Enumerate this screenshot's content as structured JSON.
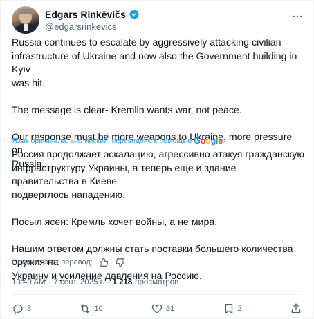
{
  "author": {
    "display_name": "Edgars Rinkēvičs",
    "handle": "@edgarsrinkevics",
    "verified_color": "#1d9bf0"
  },
  "tweet": {
    "original": [
      "Russia continues to escalate by aggressively attacking civilian",
      "infrastructure of Ukraine and now also the Government  building in Kyiv",
      "was hit.",
      "The message is clear- Kremlin wants war, not peace.",
      "Our response must be more weapons to Ukraine, more pressure on",
      "Russia."
    ],
    "translation_notice": "Язык оригинала: английский, переведено с помощью",
    "translation_provider": "Google",
    "translated": [
      "Россия продолжает эскалацию, агрессивно атакуя гражданскую",
      "инфраструктуру Украины, а теперь еще и здание правительства в Киеве",
      "подверглось нападению.",
      "Посыл ясен: Кремль хочет войны, а не мира.",
      "Нашим ответом должны стать поставки большего количества оружия на",
      "Украину и усиление давления на Россию."
    ],
    "rate_translation": "Оцените этот перевод:",
    "time": "10:40 AM",
    "date": "7 сент. 2025 г.",
    "separator": "·",
    "views_count": "1 218",
    "views_label": "просмотров"
  },
  "actions": {
    "replies": "3",
    "reposts": "10",
    "likes": "31",
    "bookmarks": "2"
  },
  "icons": {
    "more": "more-icon",
    "reply": "reply-icon",
    "repost": "repost-icon",
    "like": "heart-icon",
    "bookmark": "bookmark-icon",
    "share": "share-icon",
    "thumbs_up": "thumbs-up-icon",
    "thumbs_down": "thumbs-down-icon"
  }
}
